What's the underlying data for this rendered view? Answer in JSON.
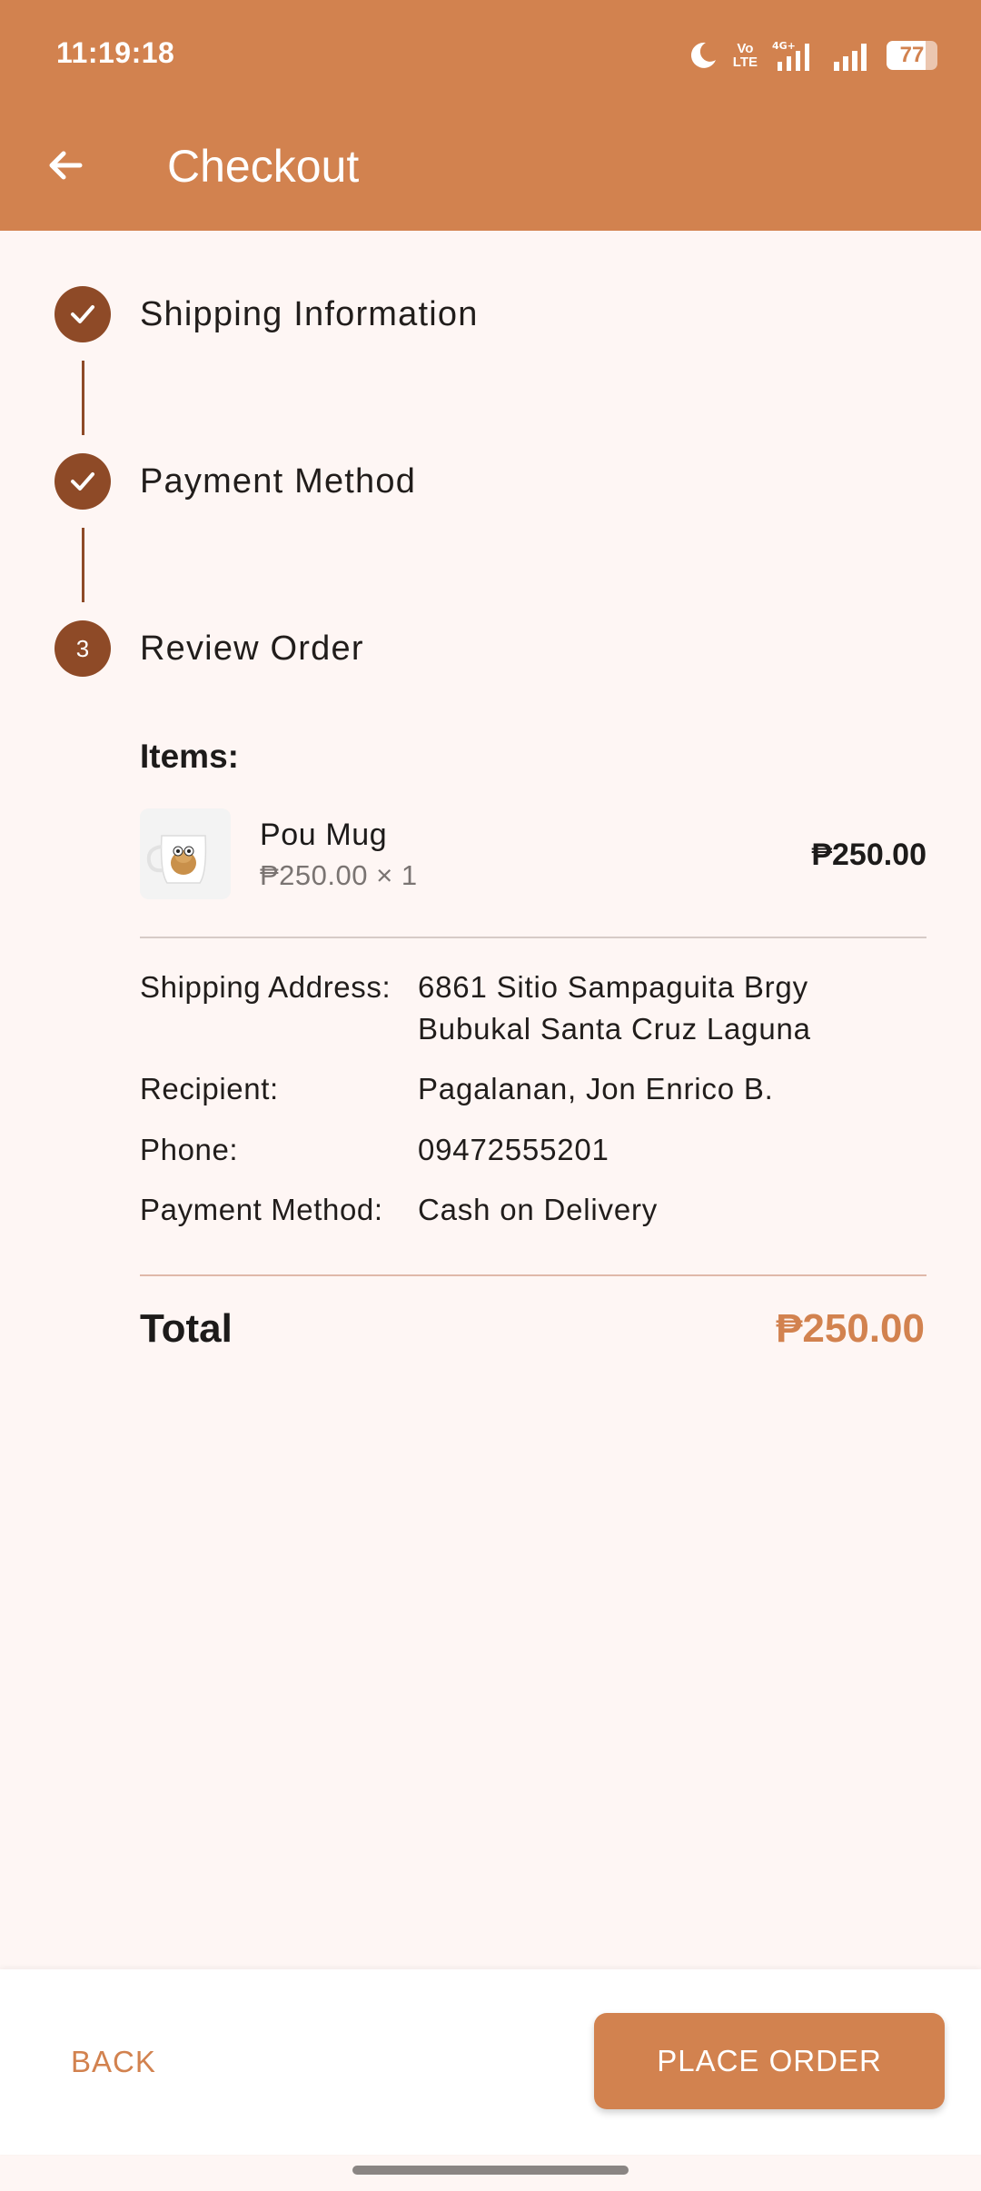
{
  "status_bar": {
    "time": "11:19:18",
    "network_label": "Vo LTE",
    "signal_label": "4G+",
    "battery_level": 77,
    "battery_text": "77"
  },
  "app_bar": {
    "title": "Checkout"
  },
  "stepper": {
    "steps": [
      {
        "label": "Shipping Information",
        "state": "completed"
      },
      {
        "label": "Payment Method",
        "state": "completed"
      },
      {
        "label": "Review Order",
        "state": "active",
        "number": "3"
      }
    ]
  },
  "review": {
    "items_heading": "Items:",
    "items": [
      {
        "name": "Pou Mug",
        "unit_line": "₱250.00 × 1",
        "line_total": "₱250.00",
        "thumbnail": "mug-image"
      }
    ],
    "details": [
      {
        "label": "Shipping Address:",
        "value": "6861 Sitio Sampaguita Brgy Bubukal Santa Cruz Laguna"
      },
      {
        "label": "Recipient:",
        "value": "Pagalanan, Jon Enrico B."
      },
      {
        "label": "Phone:",
        "value": "09472555201"
      },
      {
        "label": "Payment Method:",
        "value": "Cash on Delivery"
      }
    ],
    "total_label": "Total",
    "total_value": "₱250.00"
  },
  "actions": {
    "back_label": "BACK",
    "place_order_label": "PLACE ORDER"
  },
  "colors": {
    "primary": "#D2824F",
    "step_dark": "#8E4A27",
    "background": "#FEF6F4"
  }
}
